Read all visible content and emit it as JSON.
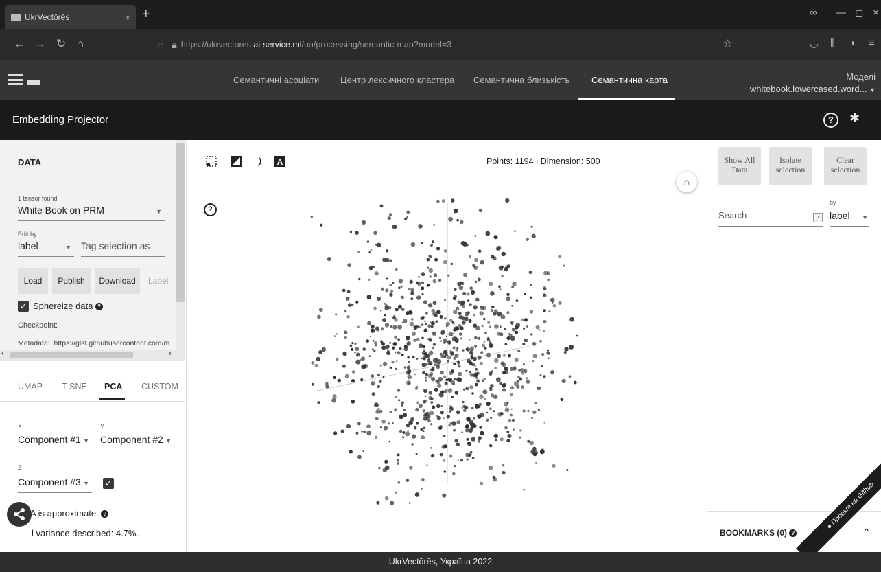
{
  "browser": {
    "tab_title": "UkrVectōrēs",
    "tab_close": "×",
    "new_tab": "+",
    "url_prefix": "https://ukrvectores.",
    "url_host": "ai-service.ml",
    "url_path": "/ua/processing/semantic-map?model=3",
    "window_controls": [
      "—",
      "◻",
      "×"
    ]
  },
  "app_header": {
    "nav_tabs": [
      "Семантичні асоціати",
      "Центр лексичного кластера",
      "Семантична близькість",
      "Семантична карта"
    ],
    "active_tab": 3,
    "model_label": "Моделі",
    "model_value": "whitebook.lowercased.word..."
  },
  "projector": {
    "title": "Embedding Projector"
  },
  "data_panel": {
    "heading": "DATA",
    "tensor_count": "1 tensor found",
    "tensor_name": "White Book on PRM",
    "edit_by_label": "Edit by",
    "edit_by_value": "label",
    "tag_selection": "Tag selection as",
    "buttons": [
      "Load",
      "Publish",
      "Download"
    ],
    "label_button": "Label",
    "sphereize_label": "Sphereize data",
    "checkpoint_label": "Checkpoint:",
    "metadata_label": "Metadata:",
    "metadata_value": "https://gist.githubusercontent.com/m"
  },
  "projection": {
    "tabs": [
      "UMAP",
      "T-SNE",
      "PCA",
      "CUSTOM"
    ],
    "active_tab": 2,
    "x_label": "X",
    "x_value": "Component #1",
    "y_label": "Y",
    "y_value": "Component #2",
    "z_label": "Z",
    "z_value": "Component #3",
    "approx_note": "PCA is approximate.",
    "variance_text": "l variance described: 4.7%."
  },
  "toolbar": {
    "stats": "Points: 1194 | Dimension: 500"
  },
  "right_panel": {
    "buttons": [
      "Show All Data",
      "Isolate selection",
      "Clear selection"
    ],
    "search_placeholder": "Search",
    "regex_glyph": ".*",
    "by_label": "by",
    "by_value": "label",
    "bookmarks_label": "BOOKMARKS (0)"
  },
  "ribbon": {
    "text": "Проект на Github"
  },
  "footer": {
    "text": "UkrVectōrēs, Україна 2022"
  },
  "colors": {
    "chrome_dark": "#1d1d1d",
    "app_header": "#353535",
    "projector_header": "#1a1a1a",
    "point": "#333333"
  }
}
